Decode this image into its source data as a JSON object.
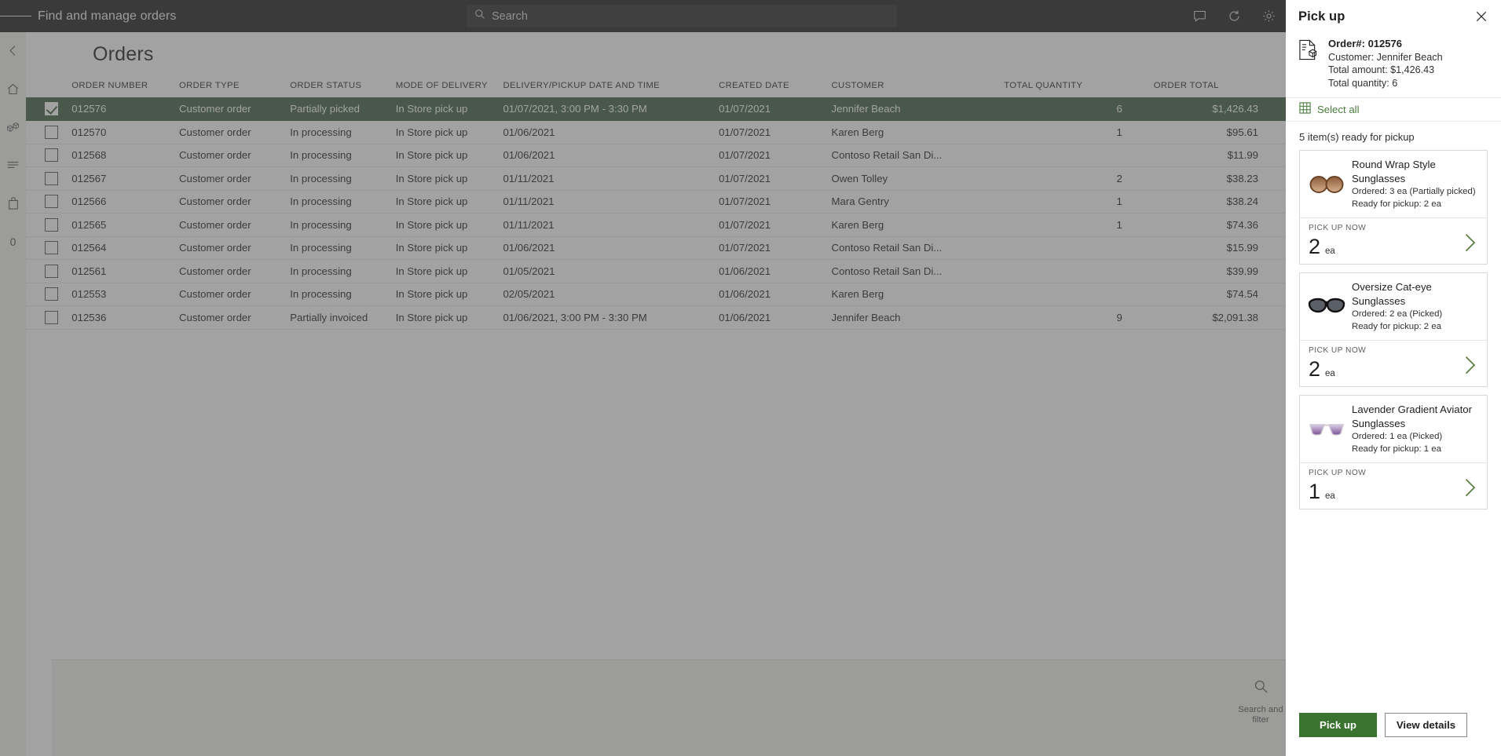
{
  "topbar": {
    "menu_icon": "hamburger-icon",
    "title": "Find and manage orders",
    "search_placeholder": "Search",
    "icons": [
      "feedback-icon",
      "refresh-icon",
      "settings-icon"
    ]
  },
  "rail": {
    "items": [
      {
        "icon": "back-arrow-icon",
        "name": "back"
      },
      {
        "icon": "home-icon",
        "name": "home"
      },
      {
        "icon": "products-icon",
        "name": "products"
      },
      {
        "icon": "list-icon",
        "name": "list"
      },
      {
        "icon": "bag-icon",
        "name": "bag"
      },
      {
        "icon": "zero-icon",
        "name": "count",
        "label": "0"
      }
    ]
  },
  "page": {
    "title": "Orders"
  },
  "table": {
    "columns": [
      "ORDER NUMBER",
      "ORDER TYPE",
      "ORDER STATUS",
      "MODE OF DELIVERY",
      "DELIVERY/PICKUP DATE AND TIME",
      "CREATED DATE",
      "CUSTOMER",
      "TOTAL QUANTITY",
      "ORDER TOTAL"
    ],
    "rows": [
      {
        "selected": true,
        "order_number": "012576",
        "order_type": "Customer order",
        "order_status": "Partially picked",
        "mode_of_delivery": "In Store pick up",
        "delivery_date": "01/07/2021, 3:00 PM - 3:30 PM",
        "created_date": "01/07/2021",
        "customer": "Jennifer Beach",
        "total_quantity": "6",
        "order_total": "$1,426.43"
      },
      {
        "selected": false,
        "order_number": "012570",
        "order_type": "Customer order",
        "order_status": "In processing",
        "mode_of_delivery": "In Store pick up",
        "delivery_date": "01/06/2021",
        "created_date": "01/07/2021",
        "customer": "Karen Berg",
        "total_quantity": "1",
        "order_total": "$95.61"
      },
      {
        "selected": false,
        "order_number": "012568",
        "order_type": "Customer order",
        "order_status": "In processing",
        "mode_of_delivery": "In Store pick up",
        "delivery_date": "01/06/2021",
        "created_date": "01/07/2021",
        "customer": "Contoso Retail San Di...",
        "total_quantity": "",
        "order_total": "$11.99"
      },
      {
        "selected": false,
        "order_number": "012567",
        "order_type": "Customer order",
        "order_status": "In processing",
        "mode_of_delivery": "In Store pick up",
        "delivery_date": "01/11/2021",
        "created_date": "01/07/2021",
        "customer": "Owen Tolley",
        "total_quantity": "2",
        "order_total": "$38.23"
      },
      {
        "selected": false,
        "order_number": "012566",
        "order_type": "Customer order",
        "order_status": "In processing",
        "mode_of_delivery": "In Store pick up",
        "delivery_date": "01/11/2021",
        "created_date": "01/07/2021",
        "customer": "Mara Gentry",
        "total_quantity": "1",
        "order_total": "$38.24"
      },
      {
        "selected": false,
        "order_number": "012565",
        "order_type": "Customer order",
        "order_status": "In processing",
        "mode_of_delivery": "In Store pick up",
        "delivery_date": "01/11/2021",
        "created_date": "01/07/2021",
        "customer": "Karen Berg",
        "total_quantity": "1",
        "order_total": "$74.36"
      },
      {
        "selected": false,
        "order_number": "012564",
        "order_type": "Customer order",
        "order_status": "In processing",
        "mode_of_delivery": "In Store pick up",
        "delivery_date": "01/06/2021",
        "created_date": "01/07/2021",
        "customer": "Contoso Retail San Di...",
        "total_quantity": "",
        "order_total": "$15.99"
      },
      {
        "selected": false,
        "order_number": "012561",
        "order_type": "Customer order",
        "order_status": "In processing",
        "mode_of_delivery": "In Store pick up",
        "delivery_date": "01/05/2021",
        "created_date": "01/06/2021",
        "customer": "Contoso Retail San Di...",
        "total_quantity": "",
        "order_total": "$39.99"
      },
      {
        "selected": false,
        "order_number": "012553",
        "order_type": "Customer order",
        "order_status": "In processing",
        "mode_of_delivery": "In Store pick up",
        "delivery_date": "02/05/2021",
        "created_date": "01/06/2021",
        "customer": "Karen Berg",
        "total_quantity": "",
        "order_total": "$74.54"
      },
      {
        "selected": false,
        "order_number": "012536",
        "order_type": "Customer order",
        "order_status": "Partially invoiced",
        "mode_of_delivery": "In Store pick up",
        "delivery_date": "01/06/2021, 3:00 PM - 3:30 PM",
        "created_date": "01/06/2021",
        "customer": "Jennifer Beach",
        "total_quantity": "9",
        "order_total": "$2,091.38"
      }
    ]
  },
  "command_bar": {
    "search_filter": {
      "icon": "search-icon",
      "label": "Search and\nfilter"
    }
  },
  "panel": {
    "title": "Pick up",
    "close_icon": "close-icon",
    "order_icon": "order-document-icon",
    "order_number": "Order#: 012576",
    "customer_line": "Customer: Jennifer Beach",
    "total_amount_line": "Total amount: $1,426.43",
    "total_quantity_line": "Total quantity: 6",
    "select_all": {
      "icon": "select-all-grid-icon",
      "label": "Select all"
    },
    "ready_count": "5 item(s) ready for pickup",
    "items": [
      {
        "image": "round-wrap-sunglasses-image",
        "name": "Round Wrap Style Sunglasses",
        "ordered": "Ordered: 3 ea (Partially picked)",
        "ready": "Ready for pickup: 2 ea",
        "pick_label": "PICK UP NOW",
        "qty": "2",
        "unit": "ea",
        "chevron": "chevron-right-icon"
      },
      {
        "image": "cat-eye-sunglasses-image",
        "name": "Oversize Cat-eye Sunglasses",
        "ordered": "Ordered: 2 ea (Picked)",
        "ready": "Ready for pickup: 2 ea",
        "pick_label": "PICK UP NOW",
        "qty": "2",
        "unit": "ea",
        "chevron": "chevron-right-icon"
      },
      {
        "image": "lavender-aviator-sunglasses-image",
        "name": "Lavender Gradient Aviator Sunglasses",
        "ordered": "Ordered: 1 ea (Picked)",
        "ready": "Ready for pickup: 1 ea",
        "pick_label": "PICK UP NOW",
        "qty": "1",
        "unit": "ea",
        "chevron": "chevron-right-icon"
      }
    ],
    "primary_button": "Pick up",
    "secondary_button": "View details"
  },
  "colors": {
    "selected_row": "#4c6b4f",
    "primary_green": "#3a7230",
    "link_green": "#4a7c3f",
    "topbar": "#2f2f2f"
  }
}
